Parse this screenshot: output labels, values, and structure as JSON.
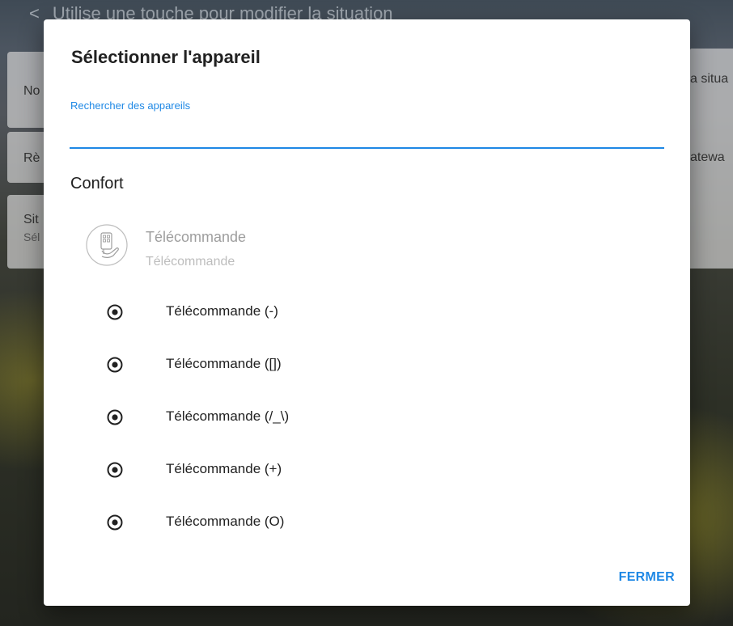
{
  "background": {
    "header_chevron": "<",
    "header_title": "Utilise une touche pour modifier la situation",
    "cards": [
      {
        "title": "No",
        "right": "a situa"
      },
      {
        "title": "Rè",
        "right": "atewa"
      },
      {
        "title": "Sit",
        "subtitle": "Sél"
      }
    ]
  },
  "dialog": {
    "title": "Sélectionner l'appareil",
    "search": {
      "label": "Rechercher des appareils",
      "value": "",
      "placeholder": ""
    },
    "section": "Confort",
    "device": {
      "icon": "remote-control-hand-icon",
      "name": "Télécommande",
      "subtitle": "Télécommande"
    },
    "options": [
      {
        "label": "Télécommande (-)"
      },
      {
        "label": "Télécommande ([])"
      },
      {
        "label": "Télécommande (/_\\)"
      },
      {
        "label": "Télécommande (+)"
      },
      {
        "label": "Télécommande (O)"
      }
    ],
    "close_label": "FERMER"
  },
  "colors": {
    "accent": "#1e88e5",
    "text_primary": "#212121",
    "text_disabled": "#9e9e9e"
  }
}
